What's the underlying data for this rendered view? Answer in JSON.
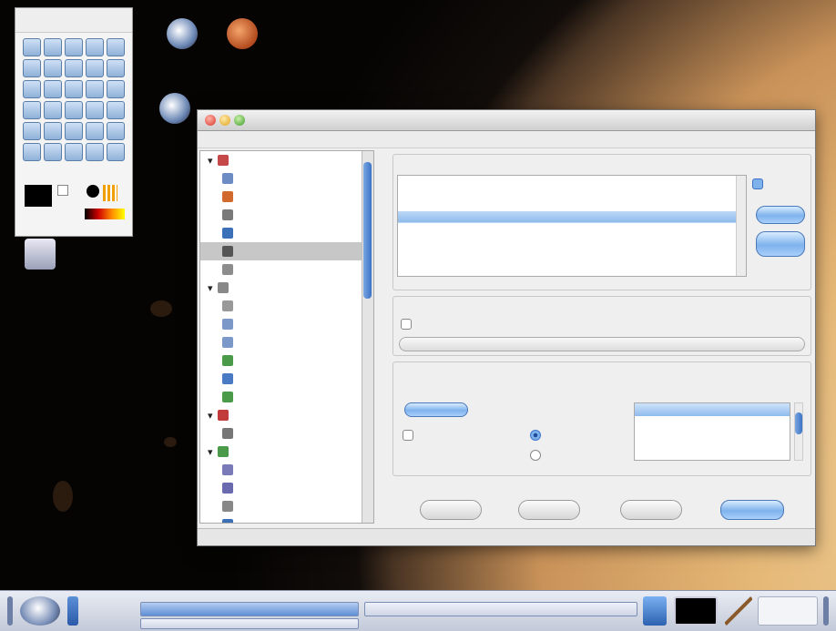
{
  "window": {
    "title": "",
    "menu": [
      "",
      ""
    ]
  },
  "sidebar": {
    "items": [
      {
        "label": "",
        "cat": true,
        "color": "#c44848"
      },
      {
        "label": "",
        "color": "#6d8cc4"
      },
      {
        "label": "",
        "color": "#d26a2d"
      },
      {
        "label": "",
        "color": "#7a7a7a"
      },
      {
        "label": "",
        "color": "#3b6fb8"
      },
      {
        "label": "",
        "color": "#555555",
        "selected": true
      },
      {
        "label": "",
        "color": "#8c8c8c"
      },
      {
        "label": "",
        "cat": true,
        "color": "#888888"
      },
      {
        "label": "",
        "color": "#999999"
      },
      {
        "label": "",
        "color": "#7b98c8"
      },
      {
        "label": "",
        "color": "#7b98c8"
      },
      {
        "label": "",
        "color": "#4a9a4a"
      },
      {
        "label": "",
        "color": "#4a7ac4"
      },
      {
        "label": "",
        "color": "#4a9a4a"
      },
      {
        "label": "",
        "cat": true,
        "color": "#c23b3b"
      },
      {
        "label": "",
        "color": "#777777"
      },
      {
        "label": "",
        "cat": true,
        "color": "#4a9a4a"
      },
      {
        "label": "",
        "color": "#7a7ab8"
      },
      {
        "label": "",
        "color": "#6a6ab0"
      },
      {
        "label": "",
        "color": "#888888"
      },
      {
        "label": "",
        "color": "#3a70b8"
      }
    ]
  },
  "themes": {
    "heading": "",
    "selected_index": 3,
    "items": [
      "",
      "",
      "",
      "",
      "",
      "",
      "",
      "",
      ""
    ],
    "checkbox": ""
  },
  "custom": {
    "heading": "",
    "checkbox": ""
  },
  "preview": {
    "heading": "",
    "caption": "",
    "tab_label": "",
    "col_header": "",
    "checkbox_1": "",
    "radio_1": "",
    "checkbox_2": "",
    "radio_2": "",
    "table_headers": [
      "",
      ""
    ],
    "table_rows": [
      [
        "",
        ""
      ],
      [
        "",
        ""
      ],
      [
        "",
        ""
      ]
    ]
  },
  "buttons": {
    "help": "",
    "defaults": "",
    "reset": "",
    "apply": ""
  },
  "status": "",
  "desktop_icons": [
    {
      "label": "",
      "glyph": "konqueror-icon"
    },
    {
      "label": "",
      "glyph": "mars-icon"
    },
    {
      "label": "",
      "glyph": "konqueror-icon"
    },
    {
      "label": "",
      "glyph": "trash-icon"
    }
  ],
  "panel": {
    "tasks": [
      {
        "label": "",
        "active": true
      },
      {
        "label": "",
        "active": false
      },
      {
        "label": "",
        "active": false
      }
    ],
    "clock": ""
  },
  "colors": {
    "accent": "#3b73c7",
    "selection": "#8fbbec"
  }
}
